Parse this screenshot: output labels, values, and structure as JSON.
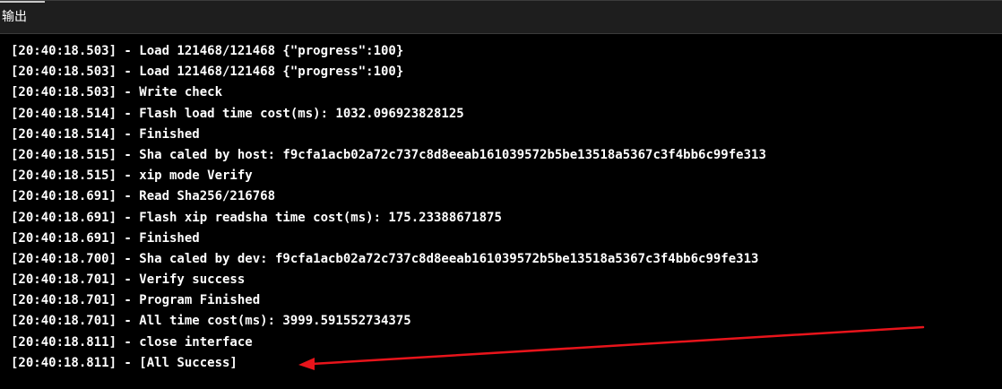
{
  "panel": {
    "title": "输出"
  },
  "log": {
    "lines": [
      "[20:40:18.503] - Load 121468/121468 {\"progress\":100}",
      "[20:40:18.503] - Load 121468/121468 {\"progress\":100}",
      "[20:40:18.503] - Write check",
      "[20:40:18.514] - Flash load time cost(ms): 1032.096923828125",
      "[20:40:18.514] - Finished",
      "[20:40:18.515] - Sha caled by host: f9cfa1acb02a72c737c8d8eeab161039572b5be13518a5367c3f4bb6c99fe313",
      "[20:40:18.515] - xip mode Verify",
      "[20:40:18.691] - Read Sha256/216768",
      "[20:40:18.691] - Flash xip readsha time cost(ms): 175.23388671875",
      "[20:40:18.691] - Finished",
      "[20:40:18.700] - Sha caled by dev: f9cfa1acb02a72c737c8d8eeab161039572b5be13518a5367c3f4bb6c99fe313",
      "[20:40:18.701] - Verify success",
      "[20:40:18.701] - Program Finished",
      "[20:40:18.701] - All time cost(ms): 3999.591552734375",
      "[20:40:18.811] - close interface",
      "[20:40:18.811] - [All Success]"
    ]
  },
  "colors": {
    "background": "#000000",
    "titlebar": "#1e1e1e",
    "text": "#ffffff",
    "annotation_arrow": "#e8141b"
  }
}
